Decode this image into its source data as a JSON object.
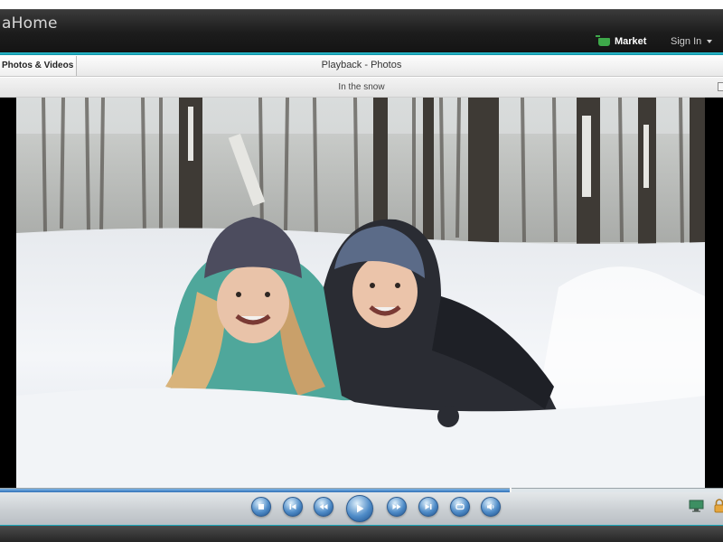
{
  "app": {
    "title": "aHome",
    "market_label": "Market",
    "signin_label": "Sign In"
  },
  "tabs": {
    "active_tab_label": "Photos & Videos",
    "window_title": "Playback - Photos"
  },
  "photo": {
    "caption": "In the snow"
  },
  "player": {
    "progress": 0.705,
    "controls": [
      {
        "name": "stop-button",
        "icon": "stop-icon"
      },
      {
        "name": "previous-button",
        "icon": "skip-previous-icon"
      },
      {
        "name": "rewind-button",
        "icon": "rewind-icon"
      },
      {
        "name": "play-button",
        "icon": "play-icon"
      },
      {
        "name": "fast-forward-button",
        "icon": "fast-forward-icon"
      },
      {
        "name": "next-button",
        "icon": "skip-next-icon"
      },
      {
        "name": "repeat-button",
        "icon": "repeat-icon"
      },
      {
        "name": "volume-button",
        "icon": "speaker-icon"
      }
    ]
  },
  "colors": {
    "accent": "#1aa9bd",
    "titlebar": "#1c1c1c",
    "market_icon": "#3ea84a",
    "control_blue": "#4f8cc8"
  }
}
